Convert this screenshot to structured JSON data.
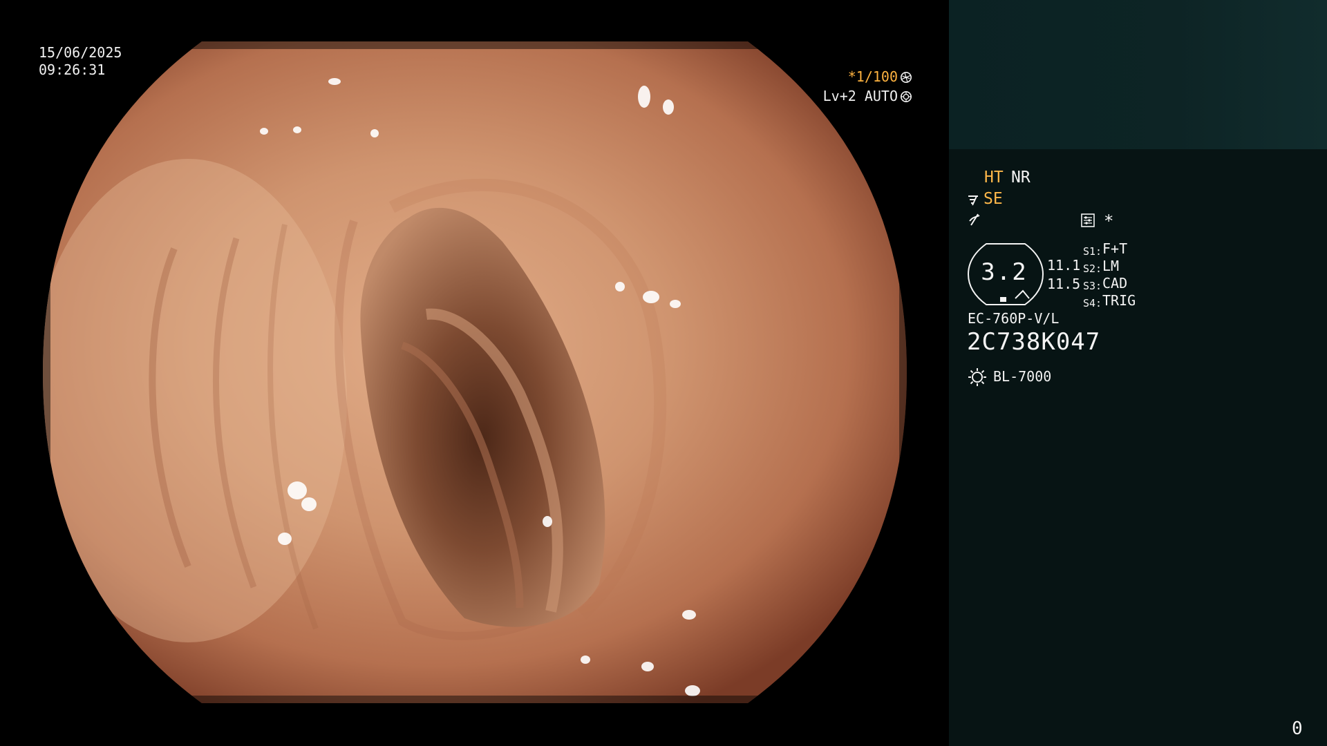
{
  "screen": {
    "date": "15/06/2025",
    "time": "09:26:31",
    "shutter": "*1/100",
    "shutter_icon": "aperture-icon",
    "level": "Lv+2 AUTO",
    "level_icon": "iris-icon"
  },
  "panel": {
    "ht_label": "HT",
    "nr_label": "NR",
    "se_label": "SE",
    "se_icon": "structure-enhance-icon",
    "wave_icon": "freeze-wave-icon",
    "settings_icon": "settings-grid-icon",
    "star": "*",
    "zoom_value": "3.2",
    "badge_icon": "scope-badge-icon",
    "side_value_1": "11.1",
    "side_value_2": "11.5",
    "switches": [
      {
        "label": "S1:",
        "value": "F+T"
      },
      {
        "label": "S2:",
        "value": "LM"
      },
      {
        "label": "S3:",
        "value": "CAD"
      },
      {
        "label": "S4:",
        "value": "TRIG"
      }
    ],
    "model": "EC-760P-V/L",
    "serial": "2C738K047",
    "light_source_icon": "light-source-icon",
    "light_source": "BL-7000"
  },
  "counter": "0",
  "colors": {
    "orange": "#ffb84a",
    "panel_bg": "#071414",
    "panel_top": "#0d2425",
    "tissue": "#c98a67"
  }
}
